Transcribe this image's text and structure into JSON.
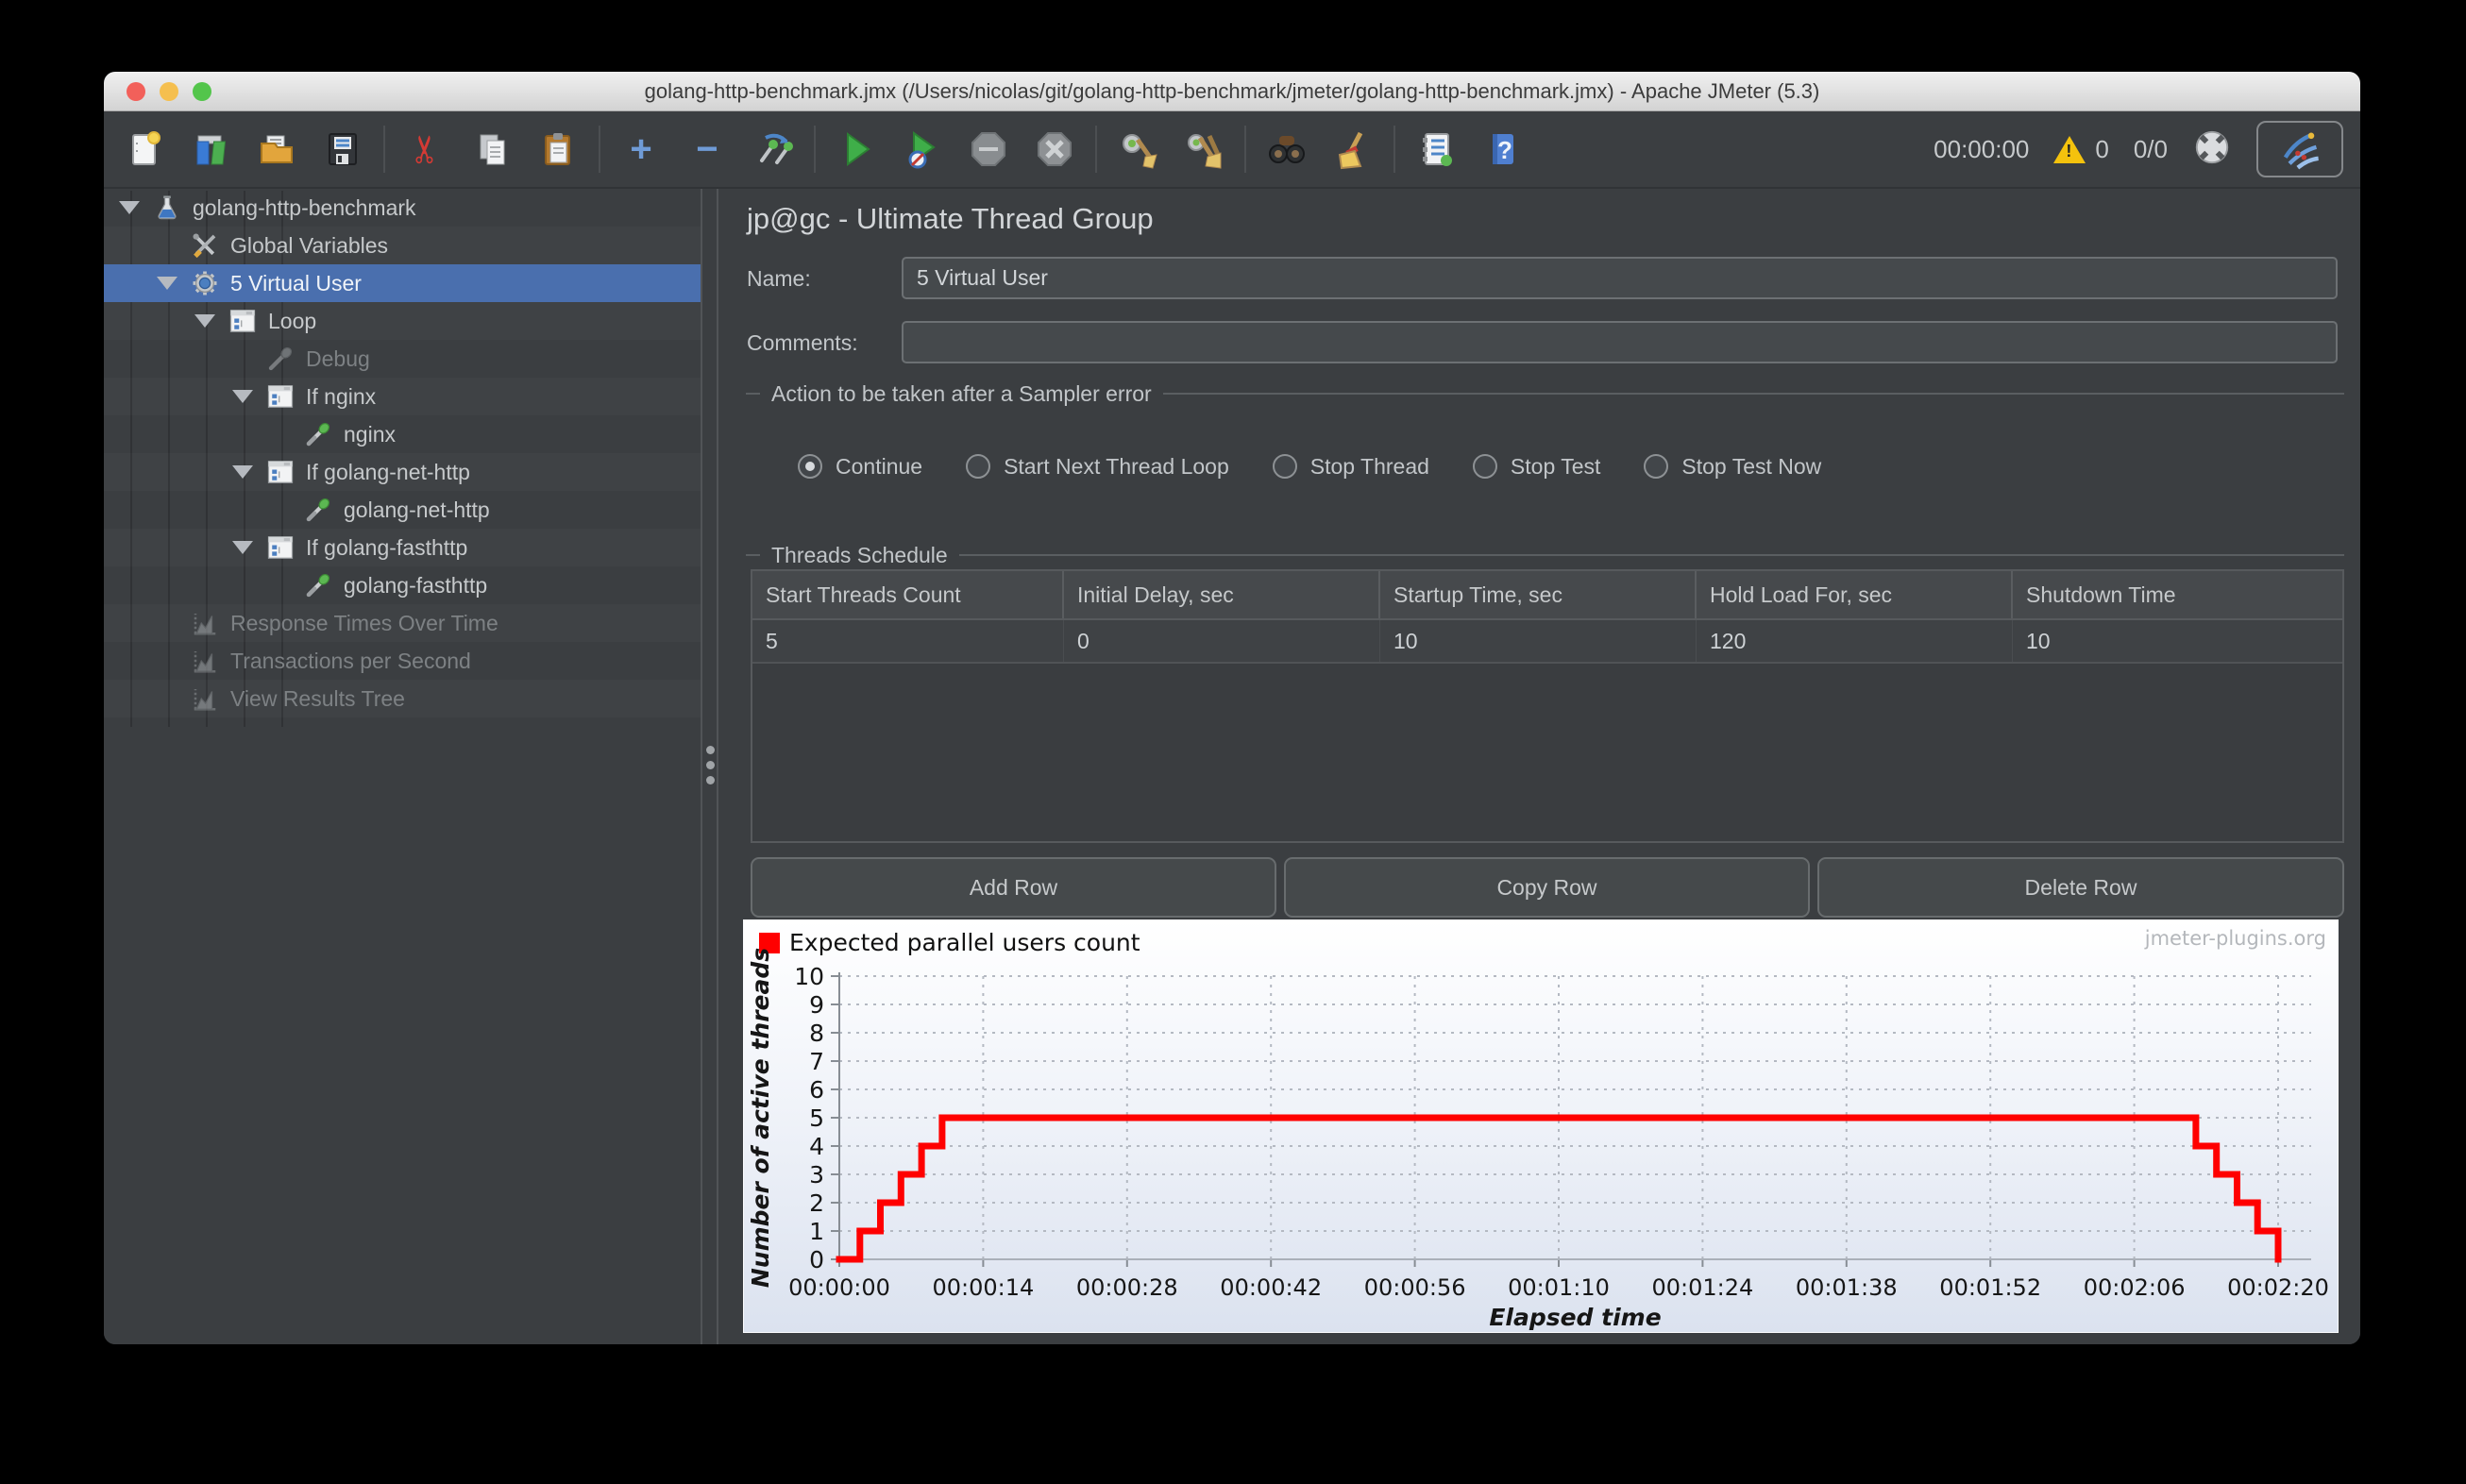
{
  "window": {
    "title": "golang-http-benchmark.jmx (/Users/nicolas/git/golang-http-benchmark/jmeter/golang-http-benchmark.jmx) - Apache JMeter (5.3)",
    "traffic_lights": [
      "close",
      "minimize",
      "zoom"
    ]
  },
  "toolbar": {
    "icons": [
      "new-file",
      "templates",
      "open-file",
      "save",
      "cut",
      "copy",
      "paste",
      "add",
      "remove",
      "toggle",
      "start",
      "start-no-timers",
      "stop",
      "shutdown",
      "clear",
      "clear-all",
      "search",
      "clear-search",
      "function-helper",
      "help"
    ],
    "timer": "00:00:00",
    "warning_count": "0",
    "thread_status": "0/0",
    "icon_glyphs": {
      "add": "+",
      "remove": "−",
      "help": "?",
      "warning": "!"
    }
  },
  "tree": {
    "items": [
      {
        "label": "golang-http-benchmark",
        "depth": 0,
        "icon": "test-plan-flask",
        "expander": true,
        "selected": false,
        "disabled": false
      },
      {
        "label": "Global Variables",
        "depth": 1,
        "icon": "tools",
        "expander": false,
        "selected": false,
        "disabled": false
      },
      {
        "label": "5 Virtual User",
        "depth": 1,
        "icon": "gear",
        "expander": true,
        "selected": true,
        "disabled": false
      },
      {
        "label": "Loop",
        "depth": 2,
        "icon": "controller",
        "expander": true,
        "selected": false,
        "disabled": false
      },
      {
        "label": "Debug",
        "depth": 3,
        "icon": "dropper-disabled",
        "expander": false,
        "selected": false,
        "disabled": true
      },
      {
        "label": "If nginx",
        "depth": 3,
        "icon": "controller",
        "expander": true,
        "selected": false,
        "disabled": false
      },
      {
        "label": "nginx",
        "depth": 4,
        "icon": "dropper",
        "expander": false,
        "selected": false,
        "disabled": false
      },
      {
        "label": "If golang-net-http",
        "depth": 3,
        "icon": "controller",
        "expander": true,
        "selected": false,
        "disabled": false
      },
      {
        "label": "golang-net-http",
        "depth": 4,
        "icon": "dropper",
        "expander": false,
        "selected": false,
        "disabled": false
      },
      {
        "label": "If golang-fasthttp",
        "depth": 3,
        "icon": "controller",
        "expander": true,
        "selected": false,
        "disabled": false
      },
      {
        "label": "golang-fasthttp",
        "depth": 4,
        "icon": "dropper",
        "expander": false,
        "selected": false,
        "disabled": false
      },
      {
        "label": "Response Times Over Time",
        "depth": 1,
        "icon": "chart-listener",
        "expander": false,
        "selected": false,
        "disabled": true
      },
      {
        "label": "Transactions per Second",
        "depth": 1,
        "icon": "chart-listener",
        "expander": false,
        "selected": false,
        "disabled": true
      },
      {
        "label": "View Results Tree",
        "depth": 1,
        "icon": "chart-listener",
        "expander": false,
        "selected": false,
        "disabled": true
      }
    ]
  },
  "main": {
    "header": "jp@gc - Ultimate Thread Group",
    "name_label": "Name:",
    "name_value": "5 Virtual User",
    "comments_label": "Comments:",
    "comments_value": "",
    "sampler_error": {
      "title": "Action to be taken after a Sampler error",
      "options": [
        {
          "label": "Continue",
          "selected": true
        },
        {
          "label": "Start Next Thread Loop",
          "selected": false
        },
        {
          "label": "Stop Thread",
          "selected": false
        },
        {
          "label": "Stop Test",
          "selected": false
        },
        {
          "label": "Stop Test Now",
          "selected": false
        }
      ]
    },
    "threads_schedule": {
      "title": "Threads Schedule",
      "columns": [
        "Start Threads Count",
        "Initial Delay, sec",
        "Startup Time, sec",
        "Hold Load For, sec",
        "Shutdown Time"
      ],
      "rows": [
        [
          "5",
          "0",
          "10",
          "120",
          "10"
        ]
      ]
    },
    "buttons": [
      "Add Row",
      "Copy Row",
      "Delete Row"
    ]
  },
  "chart_data": {
    "type": "line",
    "subtype": "step",
    "legend": "Expected parallel users count",
    "watermark": "jmeter-plugins.org",
    "xlabel": "Elapsed time",
    "ylabel": "Number of active threads",
    "ylim": [
      0,
      10
    ],
    "y_ticks": [
      0,
      1,
      2,
      3,
      4,
      5,
      6,
      7,
      8,
      9,
      10
    ],
    "x_ticks": [
      {
        "sec": 0,
        "label": "00:00:00"
      },
      {
        "sec": 14,
        "label": "00:00:14"
      },
      {
        "sec": 28,
        "label": "00:00:28"
      },
      {
        "sec": 42,
        "label": "00:00:42"
      },
      {
        "sec": 56,
        "label": "00:00:56"
      },
      {
        "sec": 70,
        "label": "00:01:10"
      },
      {
        "sec": 84,
        "label": "00:01:24"
      },
      {
        "sec": 98,
        "label": "00:01:38"
      },
      {
        "sec": 112,
        "label": "00:01:52"
      },
      {
        "sec": 126,
        "label": "00:02:06"
      },
      {
        "sec": 140,
        "label": "00:02:20"
      }
    ],
    "grid": "dotted",
    "series": [
      {
        "name": "Expected parallel users count",
        "color": "#ff0000",
        "step_points": [
          [
            0,
            0
          ],
          [
            2,
            0
          ],
          [
            2,
            1
          ],
          [
            4,
            1
          ],
          [
            4,
            2
          ],
          [
            6,
            2
          ],
          [
            6,
            3
          ],
          [
            8,
            3
          ],
          [
            8,
            4
          ],
          [
            10,
            4
          ],
          [
            10,
            5
          ],
          [
            132,
            5
          ],
          [
            132,
            4
          ],
          [
            134,
            4
          ],
          [
            134,
            3
          ],
          [
            136,
            3
          ],
          [
            136,
            2
          ],
          [
            138,
            2
          ],
          [
            138,
            1
          ],
          [
            140,
            1
          ],
          [
            140,
            0
          ]
        ]
      }
    ]
  }
}
